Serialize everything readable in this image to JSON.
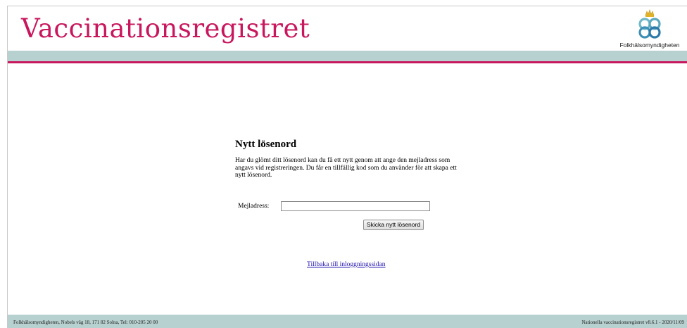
{
  "header": {
    "app_title": "Vaccinationsregistret",
    "logo_text": "Folkhälsomyndigheten"
  },
  "main": {
    "heading": "Nytt lösenord",
    "description": "Har du glömt ditt lösenord kan du få ett nytt genom att ange den mejladress som angavs vid registreringen. Du får en tillfällig kod som du använder för att skapa ett nytt lösenord.",
    "email_label": "Mejladress:",
    "email_value": "",
    "submit_label": "Skicka nytt lösenord",
    "back_link": "Tillbaka till inloggningssidan"
  },
  "footer": {
    "address": "Folkhälsomyndigheten, Nobels väg 18, 171 82 Solna, Tel: 010-205 20 00",
    "version": "Nationella vaccinationsregistret v8.6.1 - 2020/11/09"
  },
  "colors": {
    "brand_pink": "#c8175d",
    "band_teal": "#b7d1d0",
    "link_blue": "#1a0dab"
  }
}
